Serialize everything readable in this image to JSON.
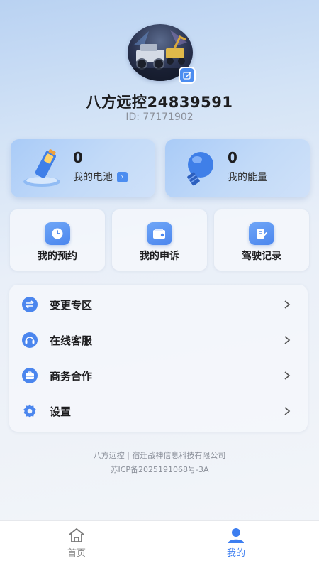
{
  "profile": {
    "username": "八方远控24839591",
    "user_id": "ID:  77171902"
  },
  "stats": {
    "battery": {
      "value": "0",
      "label": "我的电池",
      "icon": "battery-icon"
    },
    "energy": {
      "value": "0",
      "label": "我的能量",
      "icon": "lightbulb-icon"
    }
  },
  "quick_actions": [
    {
      "label": "我的预约",
      "icon": "clock-icon"
    },
    {
      "label": "我的申诉",
      "icon": "wallet-icon"
    },
    {
      "label": "驾驶记录",
      "icon": "edit-note-icon"
    }
  ],
  "menu": [
    {
      "label": "变更专区",
      "icon": "swap-icon"
    },
    {
      "label": "在线客服",
      "icon": "headset-icon"
    },
    {
      "label": "商务合作",
      "icon": "briefcase-icon"
    },
    {
      "label": "设置",
      "icon": "gear-icon"
    }
  ],
  "footer": {
    "company": "八方远控 | 宿迁战神信息科技有限公司",
    "icp": "苏ICP备2025191068号-3A"
  },
  "tabs": [
    {
      "label": "首页",
      "icon": "home-icon",
      "active": false
    },
    {
      "label": "我的",
      "icon": "user-icon",
      "active": true
    }
  ],
  "colors": {
    "accent": "#4b86ee",
    "active_tab": "#3d7ef0"
  }
}
